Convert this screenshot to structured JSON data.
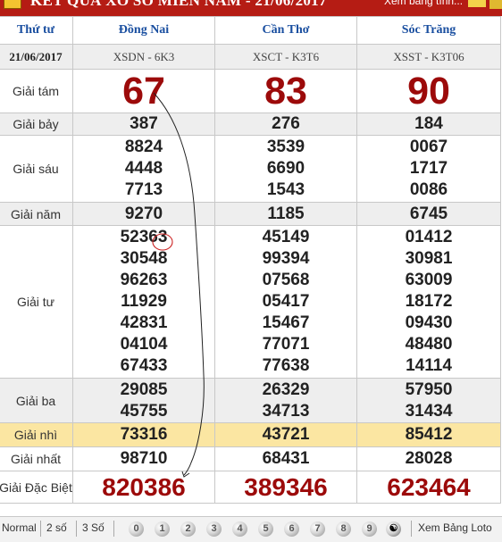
{
  "header": {
    "title": "KẾT QUẢ XỔ SỐ MIỀN NAM - 21/06/2017",
    "more_link": "Xem bảng tính..."
  },
  "table": {
    "col_day": "Thứ tư",
    "provinces": [
      "Đồng Nai",
      "Cần Thơ",
      "Sóc Trăng"
    ],
    "date": "21/06/2017",
    "codes": [
      "XSDN - 6K3",
      "XSCT - K3T6",
      "XSST - K3T06"
    ],
    "prizes": {
      "giai_tam": {
        "label": "Giải tám",
        "values": [
          "67",
          "83",
          "90"
        ]
      },
      "giai_bay": {
        "label": "Giải bảy",
        "values": [
          "387",
          "276",
          "184"
        ]
      },
      "giai_sau": {
        "label": "Giải sáu",
        "values": [
          [
            "8824",
            "4448",
            "7713"
          ],
          [
            "3539",
            "6690",
            "1543"
          ],
          [
            "0067",
            "1717",
            "0086"
          ]
        ]
      },
      "giai_nam": {
        "label": "Giải năm",
        "values": [
          "9270",
          "1185",
          "6745"
        ]
      },
      "giai_tu": {
        "label": "Giải tư",
        "values": [
          [
            "52363",
            "30548",
            "96263",
            "11929",
            "42831",
            "04104",
            "67433"
          ],
          [
            "45149",
            "99394",
            "07568",
            "05417",
            "15467",
            "77071",
            "77638"
          ],
          [
            "01412",
            "30981",
            "63009",
            "18172",
            "09430",
            "48480",
            "14114"
          ]
        ]
      },
      "giai_ba": {
        "label": "Giải ba",
        "values": [
          [
            "29085",
            "45755"
          ],
          [
            "26329",
            "34713"
          ],
          [
            "57950",
            "31434"
          ]
        ]
      },
      "giai_nhi": {
        "label": "Giải nhì",
        "values": [
          "73316",
          "43721",
          "85412"
        ]
      },
      "giai_nhat": {
        "label": "Giải nhất",
        "values": [
          "98710",
          "68431",
          "28028"
        ]
      },
      "giai_db": {
        "label": "Giải Đặc Biệt",
        "values": [
          "820386",
          "389346",
          "623464"
        ]
      }
    }
  },
  "toolbar": {
    "normal": "Normal",
    "two_digits": "2 số",
    "three_digits": "3 Số",
    "digits": [
      "0",
      "1",
      "2",
      "3",
      "4",
      "5",
      "6",
      "7",
      "8",
      "9"
    ],
    "loto_link": "Xem Bảng Loto",
    "yin_yang_icon": "yin-yang-icon"
  },
  "colors": {
    "title_bar": "#b51c14",
    "prize_red": "#9c0a0a",
    "header_blue": "#1a4fa0",
    "highlight_row": "#fbe6a2",
    "alt_row": "#eeeeee"
  }
}
